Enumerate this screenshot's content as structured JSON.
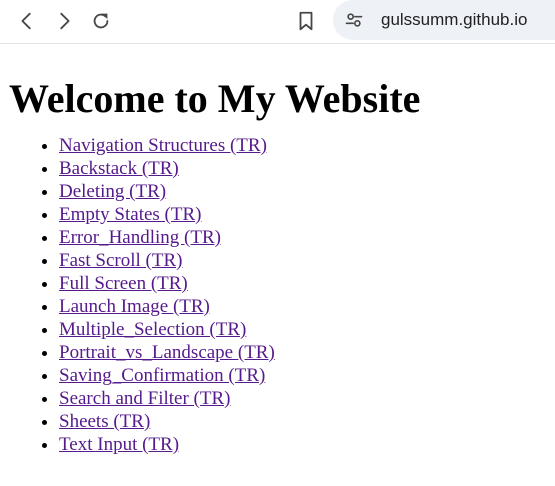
{
  "browser": {
    "url": "gulssumm.github.io",
    "icons": {
      "back": "arrow-left-icon",
      "forward": "arrow-right-icon",
      "reload": "reload-icon",
      "bookmark": "bookmark-icon",
      "site_info": "tune-icon"
    }
  },
  "page": {
    "title": "Welcome to My Website",
    "links": [
      "Navigation Structures (TR)",
      "Backstack (TR)",
      "Deleting (TR)",
      "Empty States (TR)",
      "Error_Handling (TR)",
      "Fast Scroll (TR)",
      "Full Screen (TR)",
      "Launch Image (TR)",
      "Multiple_Selection (TR)",
      "Portrait_vs_Landscape (TR)",
      "Saving_Confirmation (TR)",
      "Search and Filter (TR)",
      "Sheets (TR)",
      "Text Input (TR)"
    ]
  },
  "colors": {
    "visited_link": "#551a8b",
    "omnibox_bg": "#eef1f5",
    "icon": "#474747"
  }
}
